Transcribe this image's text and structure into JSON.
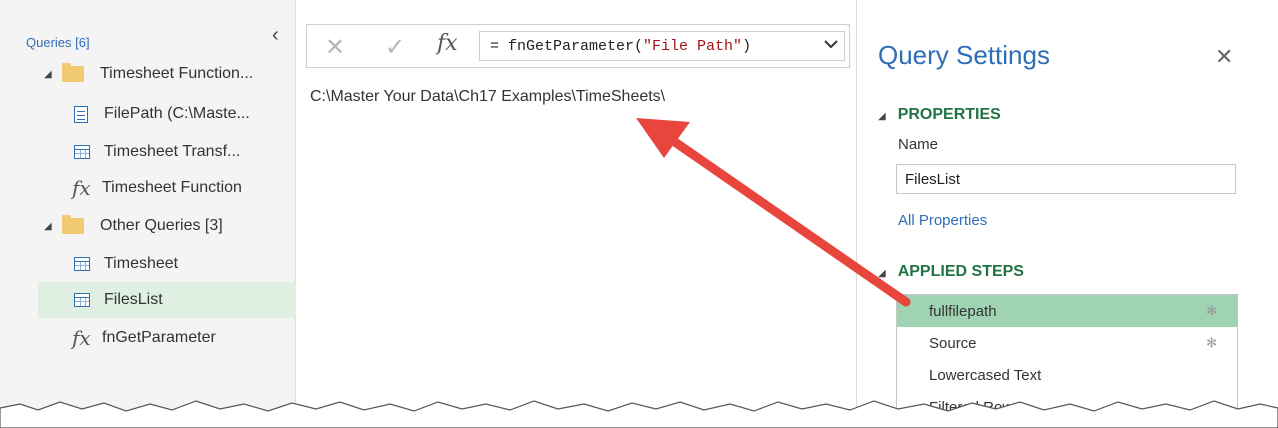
{
  "queries_pane": {
    "header": "Queries [6]",
    "collapse_glyph": "‹",
    "groups": [
      {
        "label": "Timesheet Function...",
        "items": [
          {
            "label": "FilePath (C:\\Maste...",
            "icon": "parameter-icon"
          },
          {
            "label": "Timesheet Transf...",
            "icon": "table-icon"
          },
          {
            "label": "Timesheet Function",
            "icon": "function-icon"
          }
        ]
      },
      {
        "label": "Other Queries [3]",
        "items": [
          {
            "label": "Timesheet",
            "icon": "table-icon"
          },
          {
            "label": "FilesList",
            "icon": "table-icon",
            "selected": true
          },
          {
            "label": "fnGetParameter",
            "icon": "function-icon"
          }
        ]
      }
    ]
  },
  "formula_bar": {
    "cancel": "✕",
    "commit": "✓",
    "fx": "fx",
    "formula_prefix": "= fnGetParameter(",
    "formula_string": "\"File Path\"",
    "formula_suffix": ")",
    "dropdown": "⌄"
  },
  "result": {
    "value": "C:\\Master Your Data\\Ch17 Examples\\TimeSheets\\"
  },
  "query_settings": {
    "title": "Query Settings",
    "close": "✕",
    "properties_header": "PROPERTIES",
    "name_label": "Name",
    "name_value": "FilesList",
    "all_properties": "All Properties",
    "applied_steps_header": "APPLIED STEPS",
    "steps": [
      {
        "label": "fullfilepath",
        "gear": true,
        "selected": true
      },
      {
        "label": "Source",
        "gear": true
      },
      {
        "label": "Lowercased Text",
        "gear": false
      },
      {
        "label": "Filtered Rows",
        "gear": true
      }
    ]
  },
  "colors": {
    "accent_blue": "#2e6eb5",
    "section_green": "#217346",
    "selected_step": "#9fd3b2",
    "selected_query": "#dff0e3",
    "annotation_arrow": "#e8453c"
  }
}
